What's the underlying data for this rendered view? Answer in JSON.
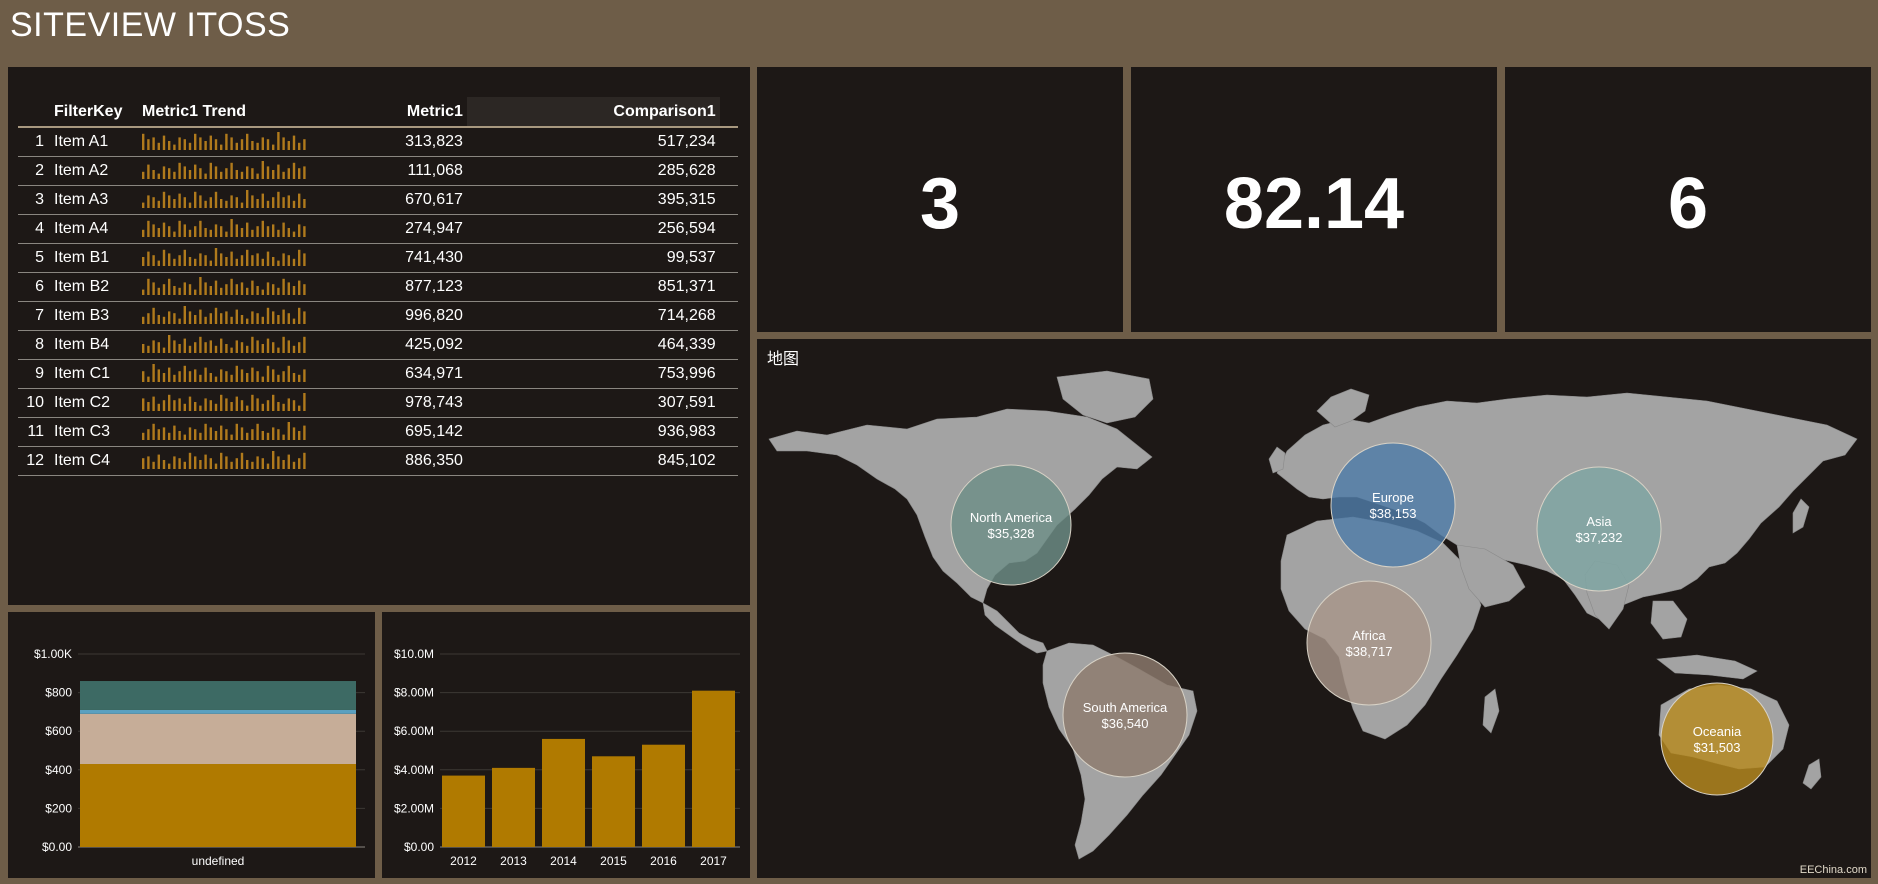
{
  "app": {
    "title": "SITEVIEW ITOSS"
  },
  "table": {
    "columns": [
      "FilterKey",
      "Metric1 Trend",
      "Metric1",
      "Comparison1"
    ],
    "rows": [
      {
        "idx": "1",
        "key": "Item A1",
        "metric": "313,823",
        "comparison": "517,234"
      },
      {
        "idx": "2",
        "key": "Item A2",
        "metric": "111,068",
        "comparison": "285,628"
      },
      {
        "idx": "3",
        "key": "Item A3",
        "metric": "670,617",
        "comparison": "395,315"
      },
      {
        "idx": "4",
        "key": "Item A4",
        "metric": "274,947",
        "comparison": "256,594"
      },
      {
        "idx": "5",
        "key": "Item B1",
        "metric": "741,430",
        "comparison": "99,537"
      },
      {
        "idx": "6",
        "key": "Item B2",
        "metric": "877,123",
        "comparison": "851,371"
      },
      {
        "idx": "7",
        "key": "Item B3",
        "metric": "996,820",
        "comparison": "714,268"
      },
      {
        "idx": "8",
        "key": "Item B4",
        "metric": "425,092",
        "comparison": "464,339"
      },
      {
        "idx": "9",
        "key": "Item C1",
        "metric": "634,971",
        "comparison": "753,996"
      },
      {
        "idx": "10",
        "key": "Item C2",
        "metric": "978,743",
        "comparison": "307,591"
      },
      {
        "idx": "11",
        "key": "Item C3",
        "metric": "695,142",
        "comparison": "936,983"
      },
      {
        "idx": "12",
        "key": "Item C4",
        "metric": "886,350",
        "comparison": "845,102"
      }
    ],
    "sparkline_values": [
      0.9,
      0.6,
      0.7,
      0.4,
      0.8,
      0.5,
      0.3,
      0.7,
      0.6,
      0.4,
      0.9,
      0.7,
      0.5,
      0.8,
      0.6,
      0.3,
      0.9,
      0.7,
      0.4,
      0.6,
      0.9,
      0.5,
      0.4,
      0.7,
      0.6,
      0.3,
      1.0,
      0.7,
      0.5,
      0.8,
      0.4,
      0.6
    ],
    "sparkline_color": "#b07a1c"
  },
  "kpis": [
    {
      "value": "3"
    },
    {
      "value": "82.14"
    },
    {
      "value": "6"
    }
  ],
  "map": {
    "label": "地图",
    "land_color": "#a3a3a3",
    "regions": [
      {
        "name": "North America",
        "value": "$35,328",
        "color": "#6e8f88"
      },
      {
        "name": "Europe",
        "value": "$38,153",
        "color": "#4f7ca8"
      },
      {
        "name": "Asia",
        "value": "$37,232",
        "color": "#7fa6a3"
      },
      {
        "name": "Africa",
        "value": "$38,717",
        "color": "#a8968a"
      },
      {
        "name": "South America",
        "value": "$36,540",
        "color": "#8e7b6e"
      },
      {
        "name": "Oceania",
        "value": "$31,503",
        "color": "#b78a1f"
      }
    ]
  },
  "chart_data": [
    {
      "type": "bar",
      "stacked": true,
      "categories": [
        "undefined"
      ],
      "series": [
        {
          "values": [
            430
          ],
          "color": "#b07a00"
        },
        {
          "values": [
            260
          ],
          "color": "#c6ad98"
        },
        {
          "values": [
            20
          ],
          "color": "#5aa0c0"
        },
        {
          "values": [
            150
          ],
          "color": "#3d6a64"
        }
      ],
      "yticks": [
        "$0.00",
        "$200",
        "$400",
        "$600",
        "$800",
        "$1.00K"
      ],
      "ylim": [
        0,
        1000
      ],
      "grid": true
    },
    {
      "type": "bar",
      "categories": [
        "2012",
        "2013",
        "2014",
        "2015",
        "2016",
        "2017"
      ],
      "values": [
        3.7,
        4.1,
        5.6,
        4.7,
        5.3,
        8.1
      ],
      "color": "#b07a00",
      "yticks": [
        "$0.00",
        "$2.00M",
        "$4.00M",
        "$6.00M",
        "$8.00M",
        "$10.0M"
      ],
      "ylim": [
        0,
        10
      ],
      "grid": true
    }
  ],
  "watermark": "EEChina.com"
}
